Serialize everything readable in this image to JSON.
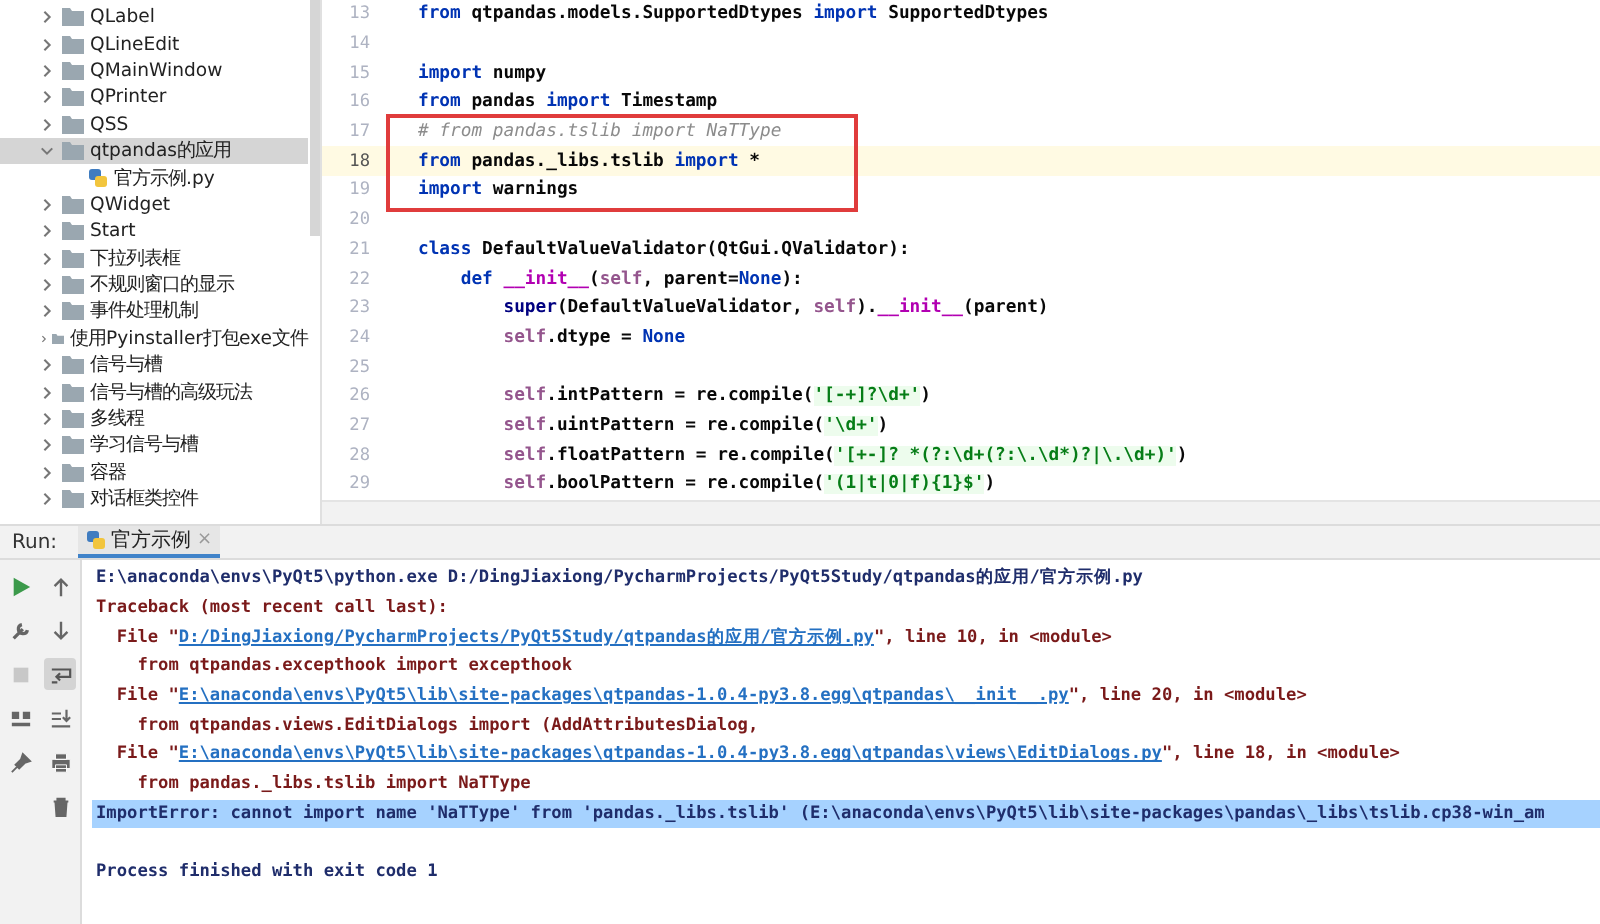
{
  "project_tree": [
    {
      "label": "QLabel",
      "kind": "folder",
      "expanded": false,
      "selected": false
    },
    {
      "label": "QLineEdit",
      "kind": "folder",
      "expanded": false,
      "selected": false
    },
    {
      "label": "QMainWindow",
      "kind": "folder",
      "expanded": false,
      "selected": false
    },
    {
      "label": "QPrinter",
      "kind": "folder",
      "expanded": false,
      "selected": false
    },
    {
      "label": "QSS",
      "kind": "folder",
      "expanded": false,
      "selected": false
    },
    {
      "label": "qtpandas的应用",
      "kind": "folder",
      "expanded": true,
      "selected": true,
      "children": [
        {
          "label": "官方示例.py",
          "kind": "file",
          "expanded": false,
          "selected": false
        }
      ]
    },
    {
      "label": "QWidget",
      "kind": "folder",
      "expanded": false,
      "selected": false
    },
    {
      "label": "Start",
      "kind": "folder",
      "expanded": false,
      "selected": false
    },
    {
      "label": "下拉列表框",
      "kind": "folder",
      "expanded": false,
      "selected": false
    },
    {
      "label": "不规则窗口的显示",
      "kind": "folder",
      "expanded": false,
      "selected": false
    },
    {
      "label": "事件处理机制",
      "kind": "folder",
      "expanded": false,
      "selected": false
    },
    {
      "label": "使用Pyinstaller打包exe文件",
      "kind": "folder",
      "expanded": false,
      "selected": false
    },
    {
      "label": "信号与槽",
      "kind": "folder",
      "expanded": false,
      "selected": false
    },
    {
      "label": "信号与槽的高级玩法",
      "kind": "folder",
      "expanded": false,
      "selected": false
    },
    {
      "label": "多线程",
      "kind": "folder",
      "expanded": false,
      "selected": false
    },
    {
      "label": "学习信号与槽",
      "kind": "folder",
      "expanded": false,
      "selected": false
    },
    {
      "label": "容器",
      "kind": "folder",
      "expanded": false,
      "selected": false
    },
    {
      "label": "对话框类控件",
      "kind": "folder",
      "expanded": false,
      "selected": false
    }
  ],
  "editor": {
    "lines": [
      {
        "number": "13",
        "current": false,
        "tokens": [
          {
            "kind": "kw",
            "text": "from"
          },
          {
            "kind": "plain",
            "text": " qtpandas.models.SupportedDtypes "
          },
          {
            "kind": "kw",
            "text": "import"
          },
          {
            "kind": "plain",
            "text": " SupportedDtypes"
          }
        ]
      },
      {
        "number": "14",
        "current": false
      },
      {
        "number": "15",
        "current": false,
        "tokens": [
          {
            "kind": "kw",
            "text": "import"
          },
          {
            "kind": "plain",
            "text": " numpy"
          }
        ]
      },
      {
        "number": "16",
        "current": false,
        "tokens": [
          {
            "kind": "kw",
            "text": "from"
          },
          {
            "kind": "plain",
            "text": " pandas "
          },
          {
            "kind": "kw",
            "text": "import"
          },
          {
            "kind": "plain",
            "text": " Timestamp"
          }
        ]
      },
      {
        "number": "17",
        "current": false,
        "tokens": [
          {
            "kind": "comment",
            "text": "# from pandas.tslib import NaTType"
          }
        ]
      },
      {
        "number": "18",
        "current": true,
        "tokens": [
          {
            "kind": "kw",
            "text": "from"
          },
          {
            "kind": "plain",
            "text": " pandas._libs.tslib "
          },
          {
            "kind": "kw",
            "text": "import"
          },
          {
            "kind": "plain",
            "text": " *"
          }
        ]
      },
      {
        "number": "19",
        "current": false,
        "tokens": [
          {
            "kind": "kw",
            "text": "import"
          },
          {
            "kind": "plain",
            "text": " warnings"
          }
        ]
      },
      {
        "number": "20",
        "current": false
      },
      {
        "number": "21",
        "current": false,
        "tokens": [
          {
            "kind": "kw",
            "text": "class"
          },
          {
            "kind": "plain",
            "text": " DefaultValueValidator(QtGui.QValidator):"
          }
        ]
      },
      {
        "number": "22",
        "current": false,
        "tokens": [
          {
            "kind": "kw",
            "text": "    def"
          },
          {
            "kind": "dunder",
            "text": " __init__"
          },
          {
            "kind": "plain",
            "text": "("
          },
          {
            "kind": "self",
            "text": "self"
          },
          {
            "kind": "plain",
            "text": ", parent="
          },
          {
            "kind": "kw",
            "text": "None"
          },
          {
            "kind": "plain",
            "text": "):"
          }
        ]
      },
      {
        "number": "23",
        "current": false,
        "tokens": [
          {
            "kind": "builtin",
            "text": "        super"
          },
          {
            "kind": "plain",
            "text": "(DefaultValueValidator, "
          },
          {
            "kind": "self",
            "text": "self"
          },
          {
            "kind": "plain",
            "text": ")."
          },
          {
            "kind": "dunder",
            "text": "__init__"
          },
          {
            "kind": "plain",
            "text": "(parent)"
          }
        ]
      },
      {
        "number": "24",
        "current": false,
        "tokens": [
          {
            "kind": "self",
            "text": "        self"
          },
          {
            "kind": "plain",
            "text": ".dtype = "
          },
          {
            "kind": "kw",
            "text": "None"
          }
        ]
      },
      {
        "number": "25",
        "current": false
      },
      {
        "number": "26",
        "current": false,
        "tokens": [
          {
            "kind": "self",
            "text": "        self"
          },
          {
            "kind": "plain",
            "text": ".intPattern = re.compile("
          },
          {
            "kind": "str",
            "text": "'[-+]?\\d+'"
          },
          {
            "kind": "plain",
            "text": ")"
          }
        ]
      },
      {
        "number": "27",
        "current": false,
        "tokens": [
          {
            "kind": "self",
            "text": "        self"
          },
          {
            "kind": "plain",
            "text": ".uintPattern = re.compile("
          },
          {
            "kind": "str",
            "text": "'\\d+'"
          },
          {
            "kind": "plain",
            "text": ")"
          }
        ]
      },
      {
        "number": "28",
        "current": false,
        "tokens": [
          {
            "kind": "self",
            "text": "        self"
          },
          {
            "kind": "plain",
            "text": ".floatPattern = re.compile("
          },
          {
            "kind": "str",
            "text": "'[+-]? *(?:\\d+(?:\\.\\d*)?|\\.\\d+)'"
          },
          {
            "kind": "plain",
            "text": ")"
          }
        ]
      },
      {
        "number": "29",
        "current": false,
        "tokens": [
          {
            "kind": "self",
            "text": "        self"
          },
          {
            "kind": "plain",
            "text": ".boolPattern = re.compile("
          },
          {
            "kind": "str",
            "text": "'(1|t|0|f){1}$'"
          },
          {
            "kind": "plain",
            "text": ")"
          }
        ]
      }
    ]
  },
  "run_panel": {
    "label": "Run:",
    "tab": {
      "label": "官方示例",
      "selected": true,
      "close": "×"
    },
    "output": [
      {
        "kind": "command",
        "segments": [
          {
            "text": "E:\\anaconda\\envs\\PyQt5\\python.exe D:/DingJiaxiong/PycharmProjects/PyQt5Study/qtpandas的应用/官方示例.py",
            "link": false
          }
        ]
      },
      {
        "kind": "error",
        "segments": [
          {
            "text": "Traceback (most recent call last):",
            "link": false
          }
        ]
      },
      {
        "kind": "error",
        "segments": [
          {
            "text": "  File \"",
            "link": false
          },
          {
            "text": "D:/DingJiaxiong/PycharmProjects/PyQt5Study/qtpandas的应用/官方示例.py",
            "link": true
          },
          {
            "text": "\", line 10, in <module>",
            "link": false
          }
        ]
      },
      {
        "kind": "error",
        "segments": [
          {
            "text": "    from qtpandas.excepthook import excepthook",
            "link": false
          }
        ]
      },
      {
        "kind": "error",
        "segments": [
          {
            "text": "  File \"",
            "link": false
          },
          {
            "text": "E:\\anaconda\\envs\\PyQt5\\lib\\site-packages\\qtpandas-1.0.4-py3.8.egg\\qtpandas\\__init__.py",
            "link": true
          },
          {
            "text": "\", line 20, in <module>",
            "link": false
          }
        ]
      },
      {
        "kind": "error",
        "segments": [
          {
            "text": "    from qtpandas.views.EditDialogs import (AddAttributesDialog,",
            "link": false
          }
        ]
      },
      {
        "kind": "error",
        "segments": [
          {
            "text": "  File \"",
            "link": false
          },
          {
            "text": "E:\\anaconda\\envs\\PyQt5\\lib\\site-packages\\qtpandas-1.0.4-py3.8.egg\\qtpandas\\views\\EditDialogs.py",
            "link": true
          },
          {
            "text": "\", line 18, in <module>",
            "link": false
          }
        ]
      },
      {
        "kind": "error",
        "segments": [
          {
            "text": "    from pandas._libs.tslib import NaTType",
            "link": false
          }
        ]
      },
      {
        "kind": "selected",
        "segments": [
          {
            "text": "ImportError: cannot import name 'NaTType' from 'pandas._libs.tslib' (E:\\anaconda\\envs\\PyQt5\\lib\\site-packages\\pandas\\_libs\\tslib.cp38-win_am",
            "link": false
          }
        ]
      },
      {
        "kind": "blank"
      },
      {
        "kind": "command",
        "segments": [
          {
            "text": "Process finished with exit code 1",
            "link": false
          }
        ]
      }
    ]
  }
}
